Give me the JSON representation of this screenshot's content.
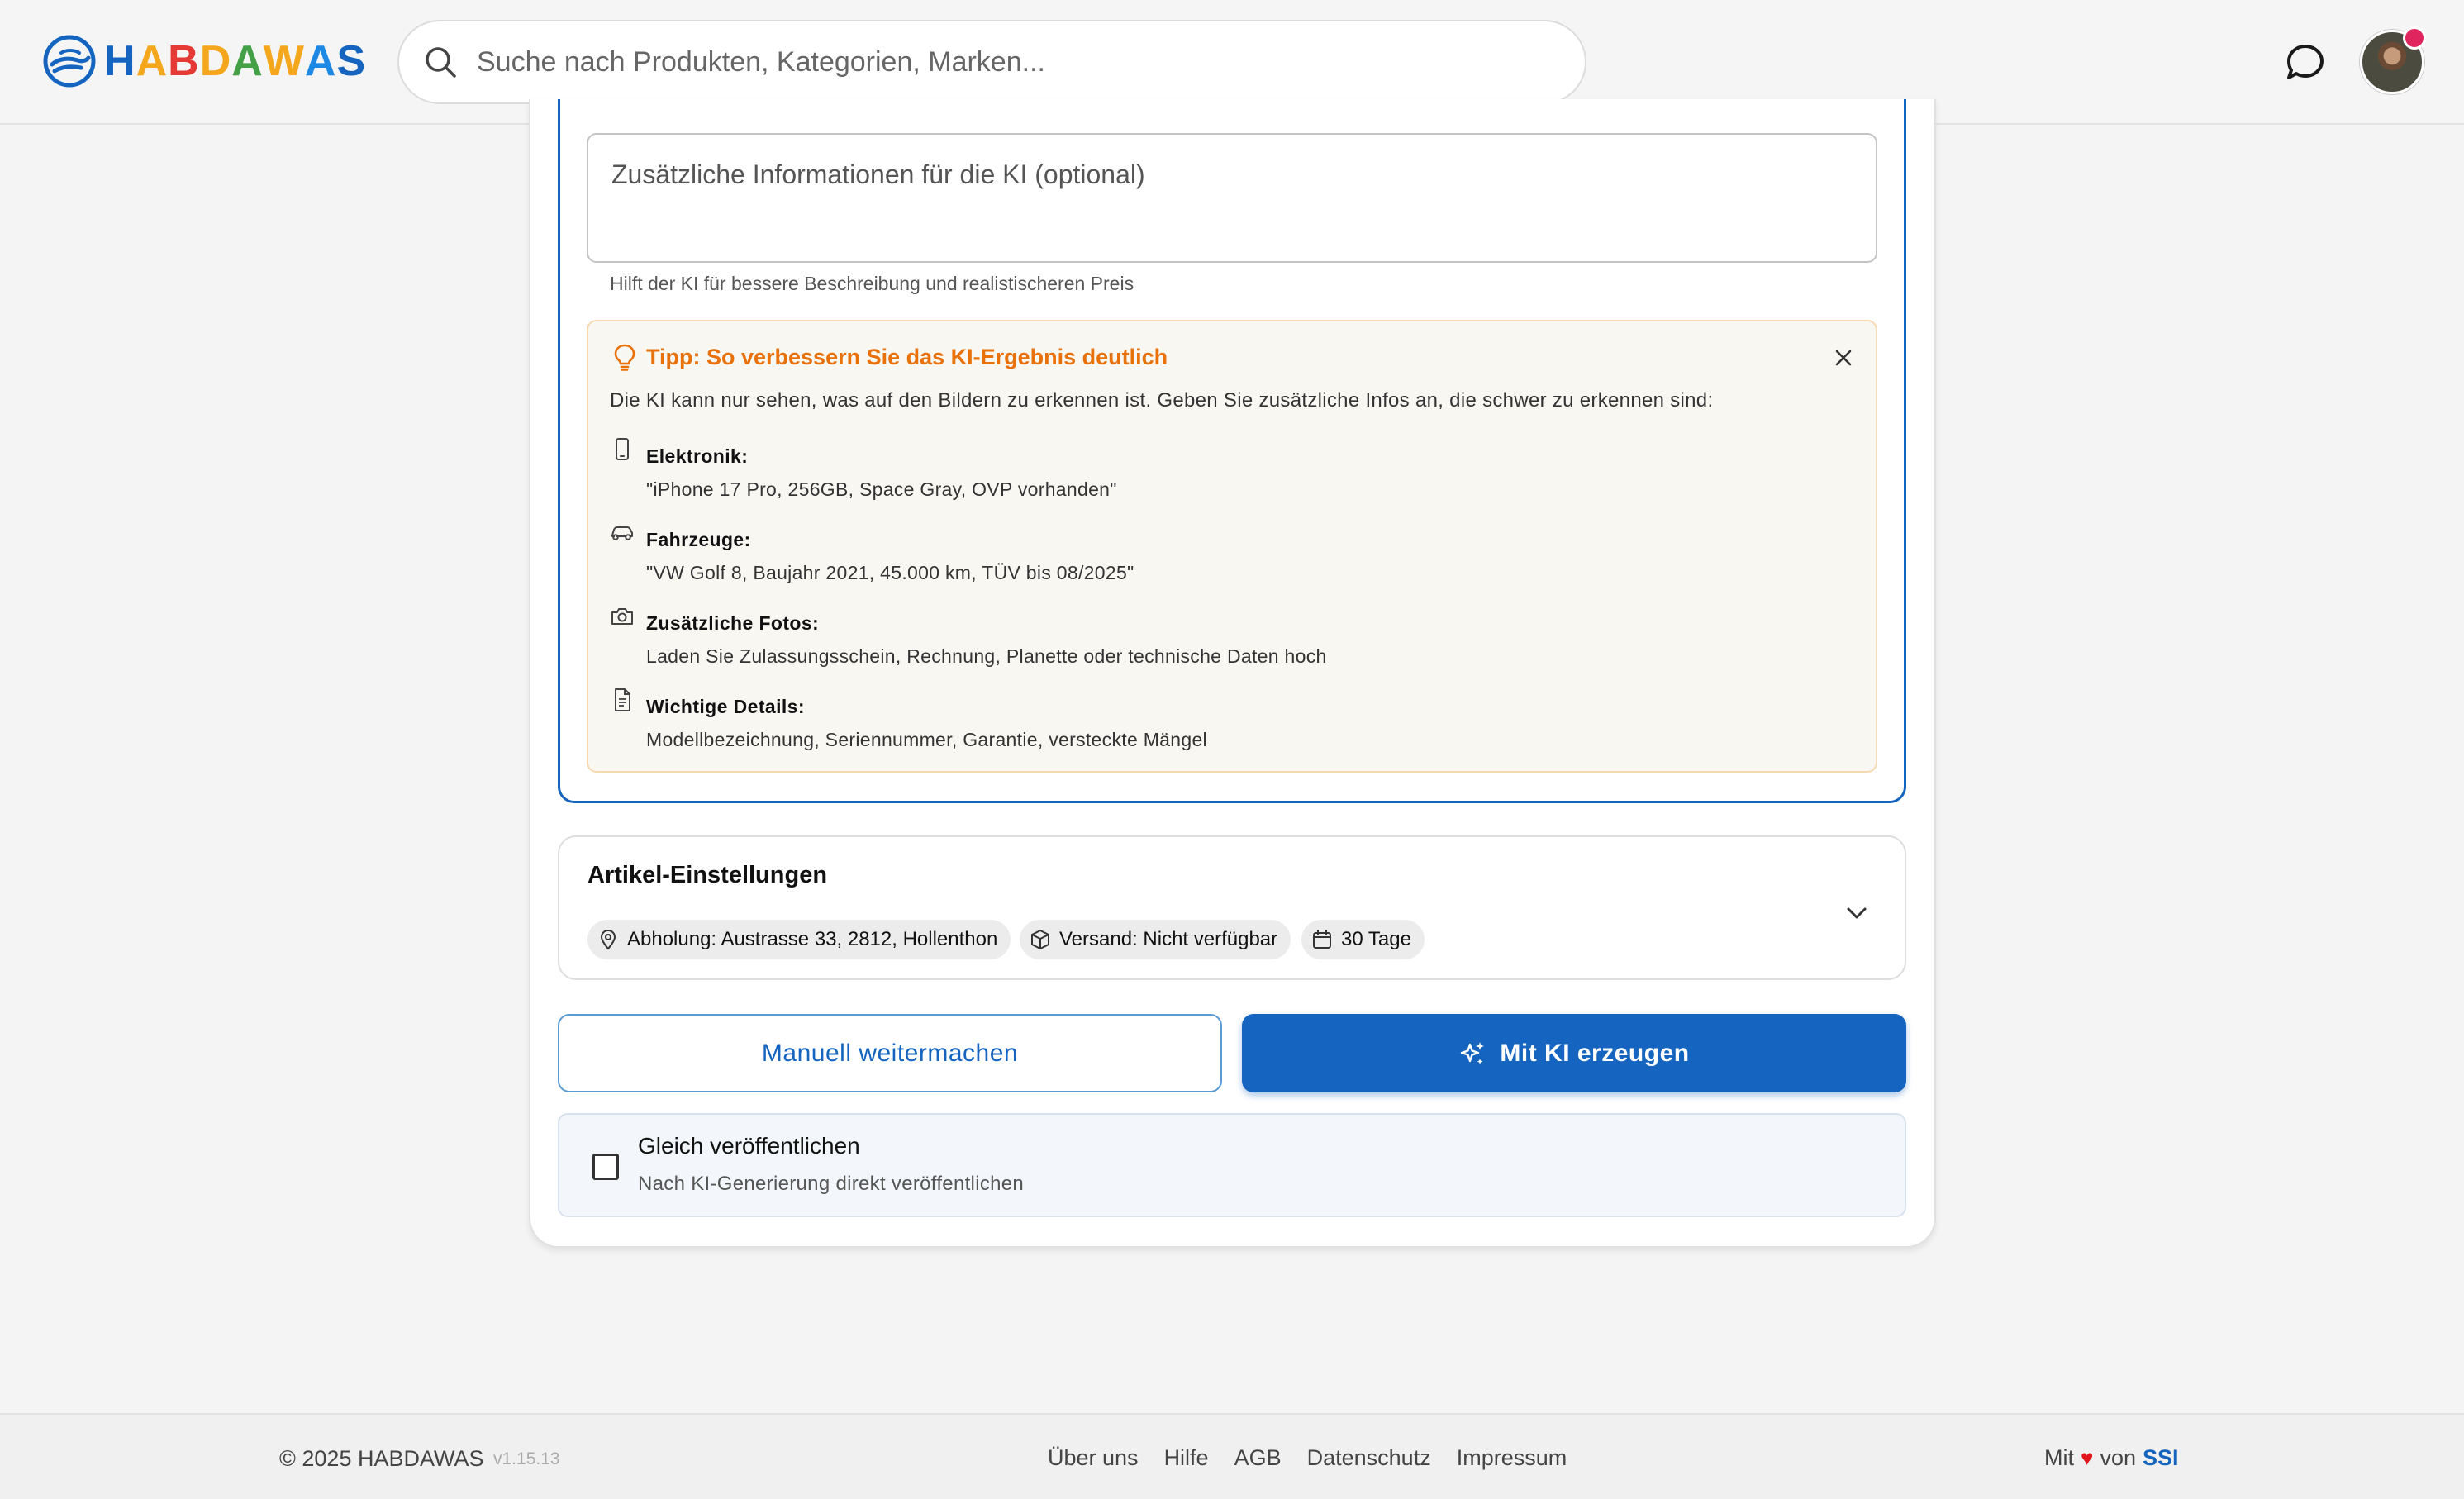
{
  "header": {
    "logo_text": "HABDAWAS",
    "logo_letters": [
      {
        "ch": "H",
        "color": "#1565c0"
      },
      {
        "ch": "A",
        "color": "#f4a71d"
      },
      {
        "ch": "B",
        "color": "#e53935"
      },
      {
        "ch": "D",
        "color": "#f4a71d"
      },
      {
        "ch": "A",
        "color": "#43a047"
      },
      {
        "ch": "W",
        "color": "#f4a71d"
      },
      {
        "ch": "A",
        "color": "#1e88e5"
      },
      {
        "ch": "S",
        "color": "#1565c0"
      }
    ],
    "search_placeholder": "Suche nach Produkten, Kategorien, Marken...",
    "icons": {
      "search": "search-icon",
      "chat": "chat-bubble-icon",
      "avatar": "user-avatar"
    }
  },
  "ai_input": {
    "placeholder": "Zusätzliche Informationen für die KI (optional)",
    "helper": "Hilft der KI für bessere Beschreibung und realistischeren Preis"
  },
  "tip": {
    "title": "Tipp: So verbessern Sie das KI-Ergebnis deutlich",
    "intro": "Die KI kann nur sehen, was auf den Bildern zu erkennen ist. Geben Sie zusätzliche Infos an, die schwer zu erkennen sind:",
    "items": [
      {
        "label": "Elektronik:",
        "desc": "\"iPhone 17 Pro, 256GB, Space Gray, OVP vorhanden\"",
        "icon": "smartphone-icon"
      },
      {
        "label": "Fahrzeuge:",
        "desc": "\"VW Golf 8, Baujahr 2021, 45.000 km, TÜV bis 08/2025\"",
        "icon": "car-icon"
      },
      {
        "label": "Zusätzliche Fotos:",
        "desc": "Laden Sie Zulassungsschein, Rechnung, Planette oder technische Daten hoch",
        "icon": "camera-icon"
      },
      {
        "label": "Wichtige Details:",
        "desc": "Modellbezeichnung, Seriennummer, Garantie, versteckte Mängel",
        "icon": "document-icon"
      }
    ],
    "accent_color": "#e8710a"
  },
  "settings": {
    "title": "Artikel-Einstellungen",
    "chips": {
      "pickup": "Abholung: Austrasse 33, 2812, Hollenthon",
      "shipping": "Versand: Nicht verfügbar",
      "duration": "30 Tage"
    }
  },
  "actions": {
    "manual": "Manuell weitermachen",
    "ai_generate": "Mit KI erzeugen",
    "primary_color": "#1565c0"
  },
  "publish": {
    "title": "Gleich veröffentlichen",
    "subtitle": "Nach KI-Generierung direkt veröffentlichen",
    "checked": false
  },
  "footer": {
    "copyright": "© 2025 HABDAWAS",
    "version": "v1.15.13",
    "links": [
      "Über uns",
      "Hilfe",
      "AGB",
      "Datenschutz",
      "Impressum"
    ],
    "made_with": "Mit",
    "heart": "♥",
    "by": "von",
    "company": "SSI"
  }
}
